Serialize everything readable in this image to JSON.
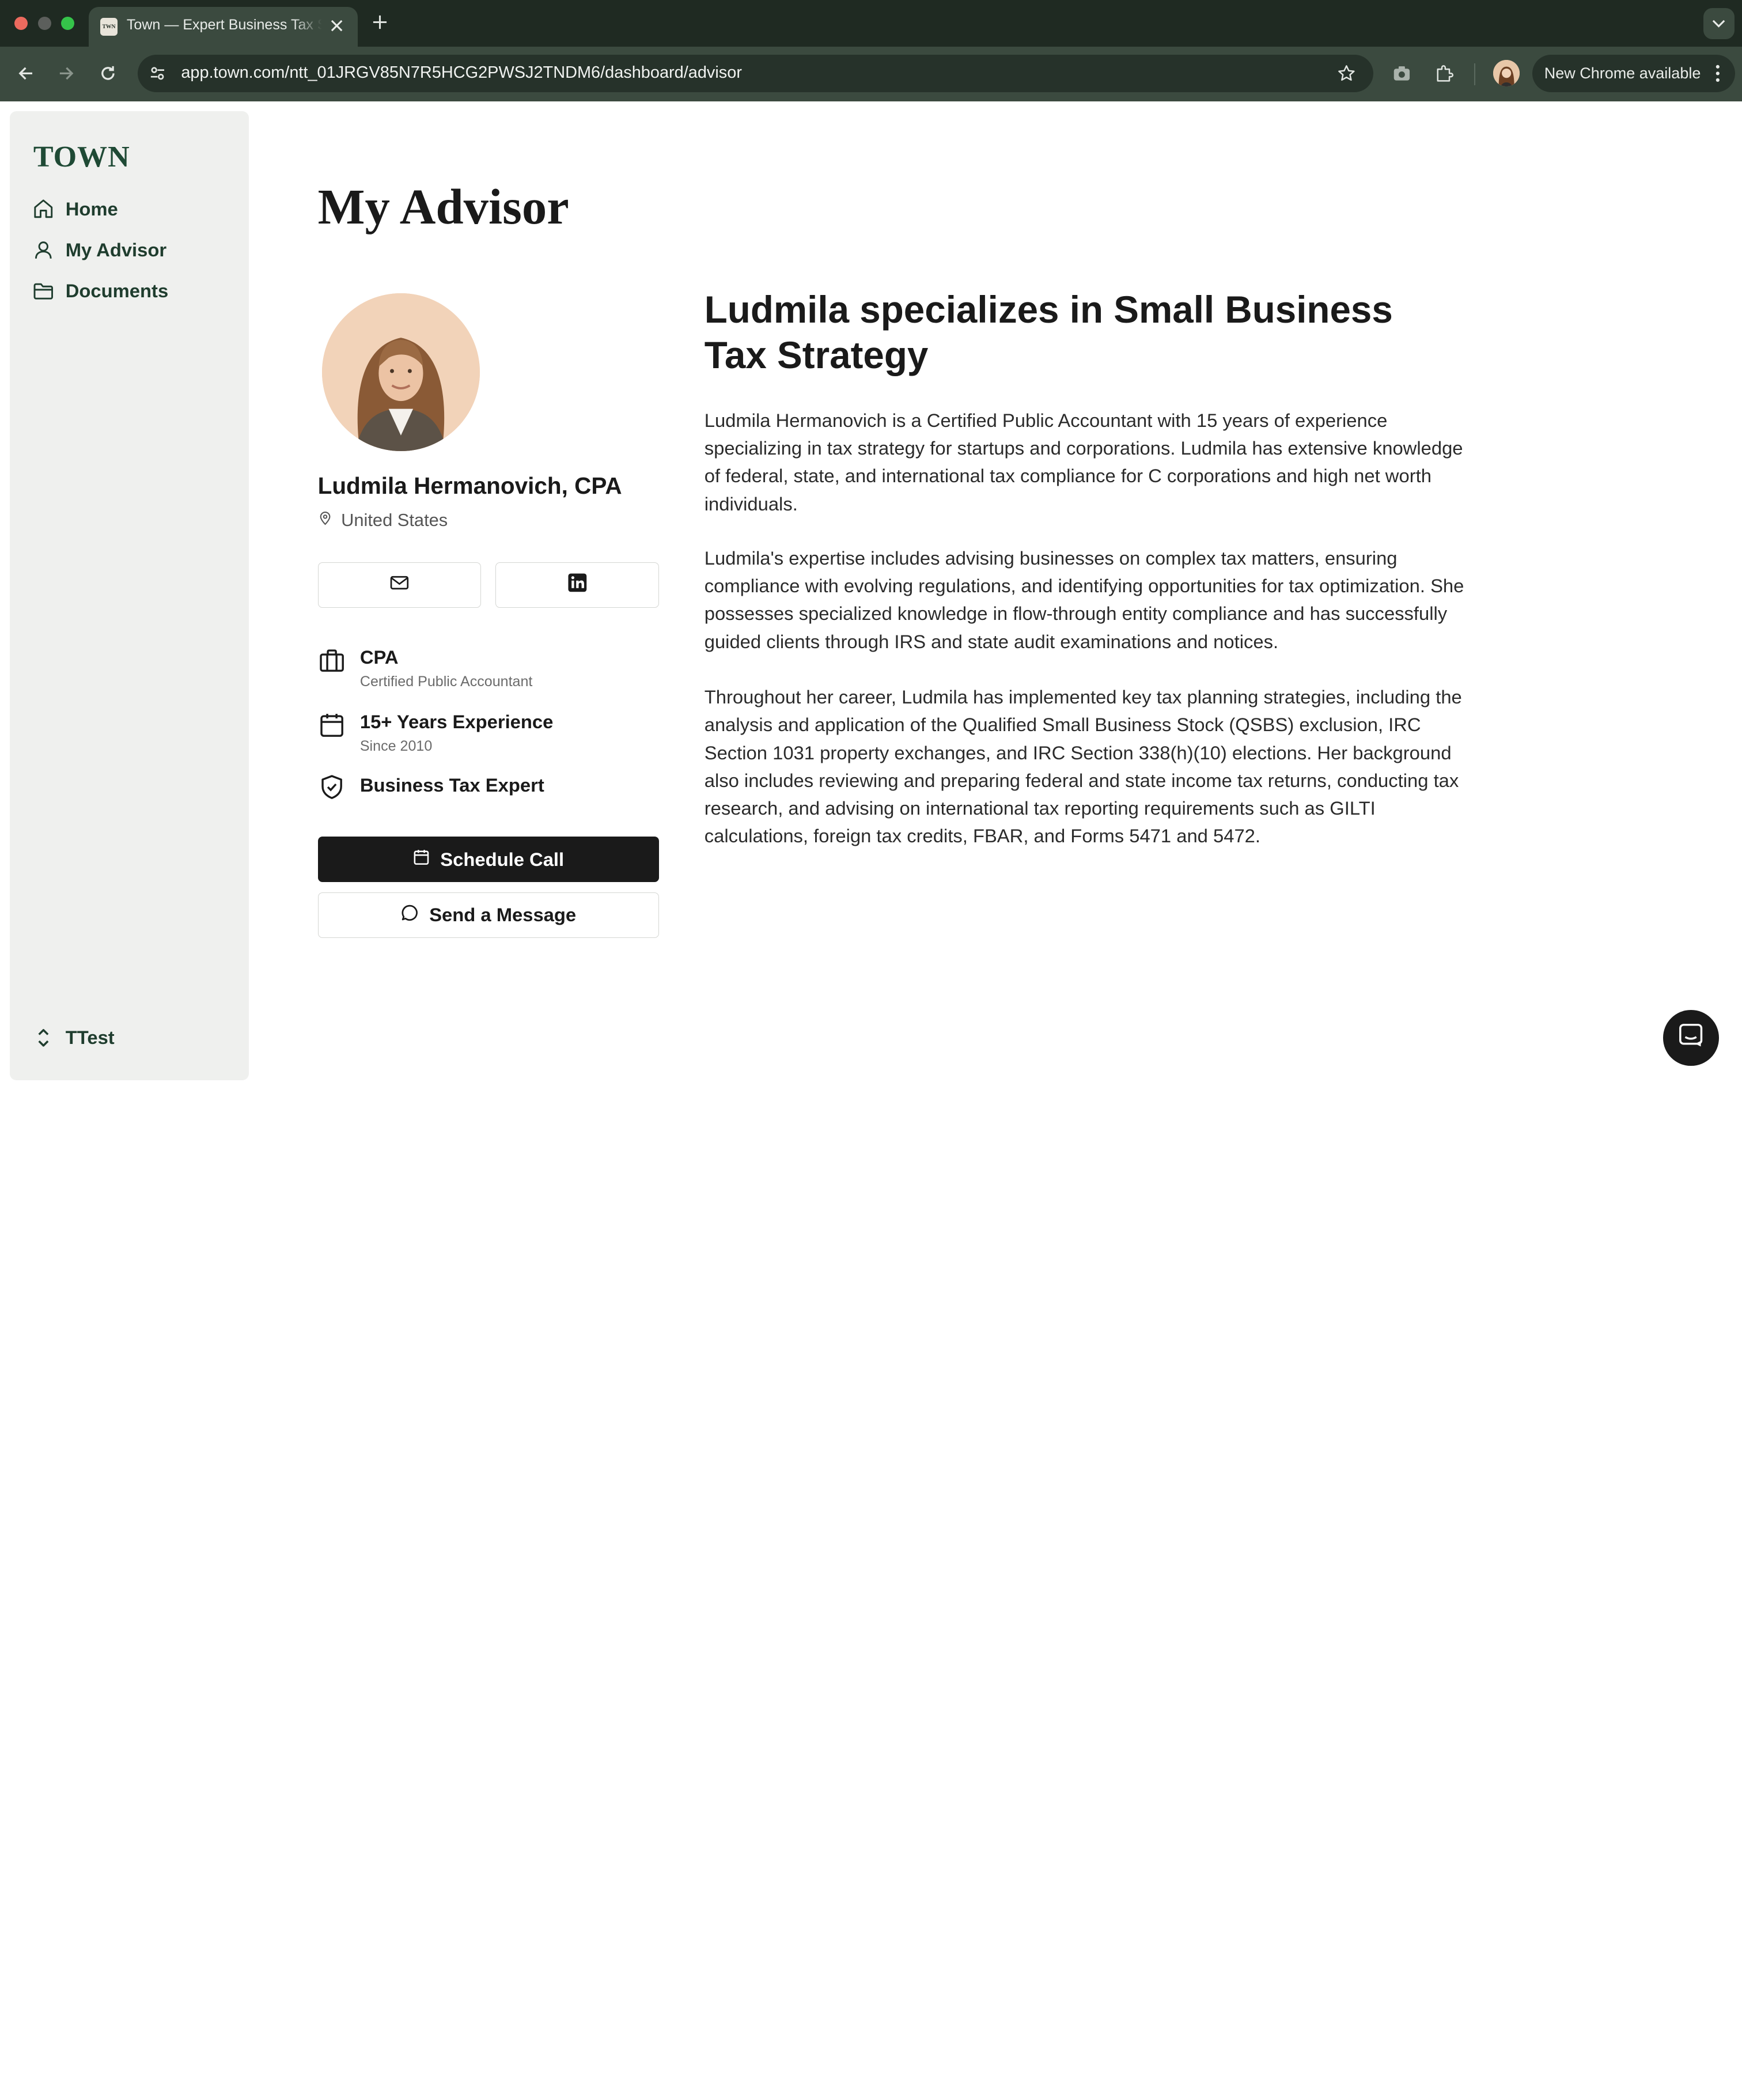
{
  "browser": {
    "tab_title": "Town — Expert Business Tax Strategy",
    "tab_favicon_text": "TWN",
    "url": "app.town.com/ntt_01JRGV85N7R5HCG2PWSJ2TNDM6/dashboard/advisor",
    "update_label": "New Chrome available"
  },
  "sidebar": {
    "logo": "TOWN",
    "items": [
      {
        "label": "Home",
        "icon": "home-icon"
      },
      {
        "label": "My Advisor",
        "icon": "user-icon"
      },
      {
        "label": "Documents",
        "icon": "folder-icon"
      }
    ],
    "account_label": "TTest"
  },
  "main": {
    "page_title": "My Advisor",
    "advisor": {
      "name": "Ludmila Hermanovich, CPA",
      "location": "United States"
    },
    "credentials": [
      {
        "title": "CPA",
        "subtitle": "Certified Public Accountant",
        "icon": "briefcase-icon"
      },
      {
        "title": "15+ Years Experience",
        "subtitle": "Since 2010",
        "icon": "calendar-icon"
      },
      {
        "title": "Business Tax Expert",
        "subtitle": "",
        "icon": "shield-check-icon"
      }
    ],
    "actions": {
      "schedule": "Schedule Call",
      "message": "Send a Message"
    },
    "headline": "Ludmila specializes in Small Business Tax Strategy",
    "bio": [
      "Ludmila Hermanovich is a Certified Public Accountant with 15 years of experience specializing in tax strategy for startups and corporations. Ludmila has extensive knowledge of federal, state, and international tax compliance for C corporations and high net worth individuals.",
      "Ludmila's expertise includes advising businesses on complex tax matters, ensuring compliance with evolving regulations, and identifying opportunities for tax optimization. She possesses specialized knowledge in flow-through entity compliance and has successfully guided clients through IRS and state audit examinations and notices.",
      "Throughout her career, Ludmila has implemented key tax planning strategies, including the analysis and application of the Qualified Small Business Stock (QSBS) exclusion, IRC Section 1031 property exchanges, and IRC Section 338(h)(10) elections. Her background also includes reviewing and preparing federal and state income tax returns, conducting tax research, and advising on international tax reporting requirements such as GILTI calculations, foreign tax credits, FBAR, and Forms 5471 and 5472."
    ]
  },
  "colors": {
    "sidebar_bg": "#eff0ee",
    "brand_green": "#1f4a35",
    "primary_button": "#1a1a1a",
    "chrome_toolbar": "#3b4a3f"
  }
}
